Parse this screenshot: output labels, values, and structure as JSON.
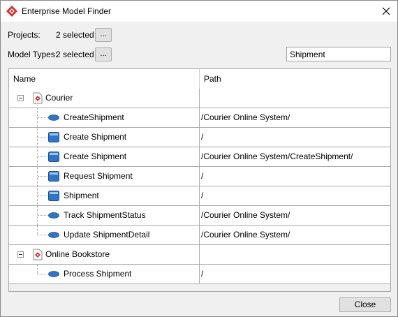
{
  "window": {
    "title": "Enterprise Model Finder"
  },
  "filters": {
    "projects_label": "Projects:",
    "projects_value": "2 selected",
    "projects_button": "...",
    "model_types_label": "Model Types:",
    "model_types_value": "2 selected",
    "model_types_button": "...",
    "search_value": "Shipment"
  },
  "table": {
    "columns": [
      "Name",
      "Path"
    ],
    "rows": [
      {
        "type": "group",
        "name": "Courier",
        "path": ""
      },
      {
        "type": "usecase",
        "name": "CreateShipment",
        "path": "/Courier Online System/"
      },
      {
        "type": "class",
        "name": "Create Shipment",
        "path": "/"
      },
      {
        "type": "class",
        "name": "Create Shipment",
        "path": "/Courier Online System/CreateShipment/"
      },
      {
        "type": "class",
        "name": "Request Shipment",
        "path": "/"
      },
      {
        "type": "class",
        "name": "Shipment",
        "path": "/"
      },
      {
        "type": "usecase",
        "name": "Track ShipmentStatus",
        "path": "/Courier Online System/"
      },
      {
        "type": "usecase",
        "name": "Update ShipmentDetail",
        "path": "/Courier Online System/"
      },
      {
        "type": "group",
        "name": "Online Bookstore",
        "path": ""
      },
      {
        "type": "usecase",
        "name": "Process Shipment",
        "path": "/"
      }
    ]
  },
  "footer": {
    "close_label": "Close"
  },
  "icons": {
    "app": "diamond-logo-icon",
    "close": "close-icon",
    "expander": "collapse-icon",
    "group": "project-icon",
    "usecase": "use-case-icon",
    "class": "model-element-icon"
  },
  "colors": {
    "accent": "#d32f2f",
    "element_blue": "#2e75c8"
  }
}
